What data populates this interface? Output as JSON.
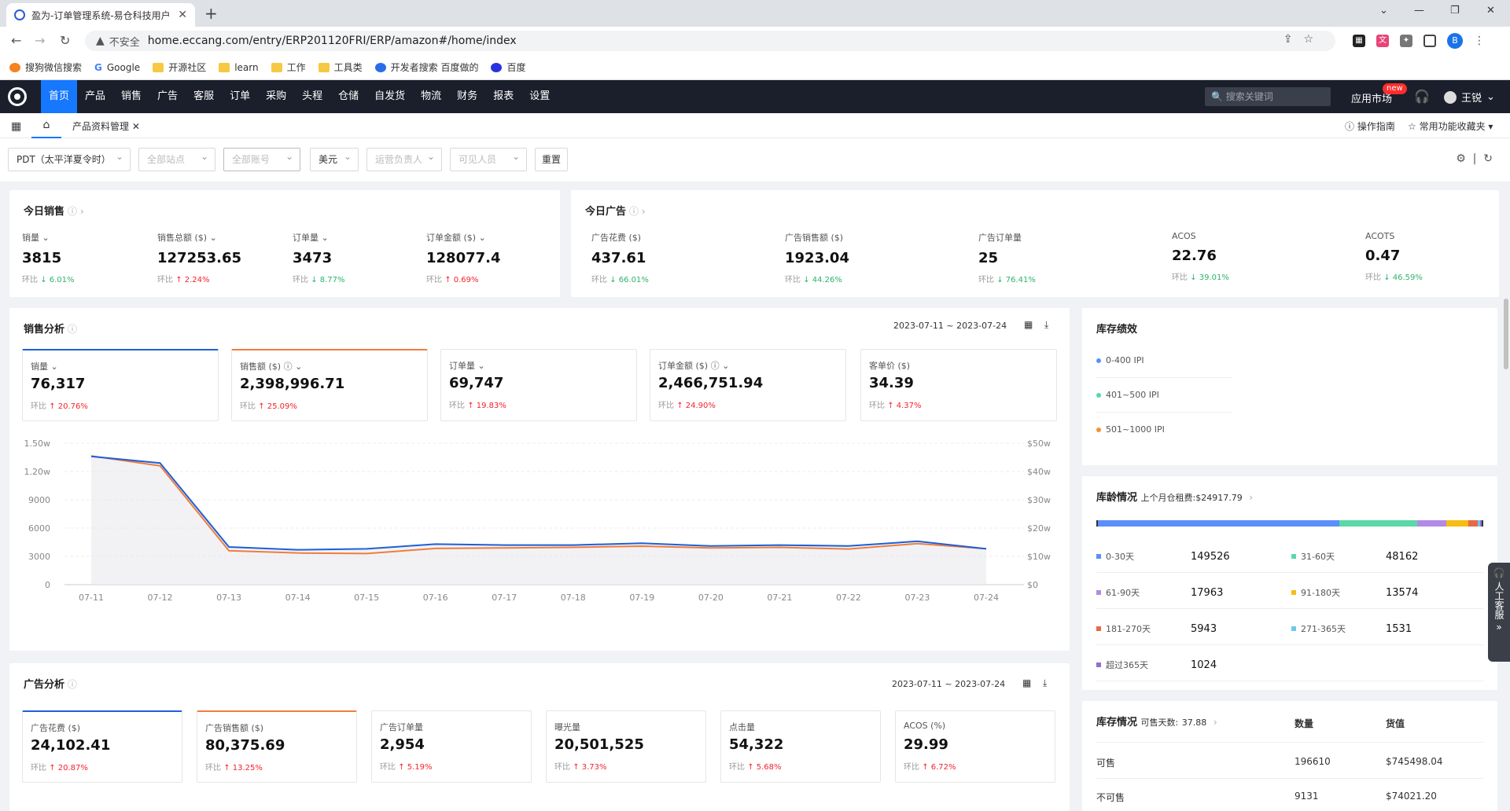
{
  "browser": {
    "tab_title": "盈为-订单管理系统-易仓科技用户",
    "security": "不安全",
    "url": "home.eccang.com/entry/ERP201120FRI/ERP/amazon#/home/index",
    "profile": "B",
    "bookmarks": [
      "搜狗微信搜索",
      "Google",
      "开源社区",
      "learn",
      "工作",
      "工具类",
      "开发者搜索 百度做的",
      "百度"
    ]
  },
  "topnav": {
    "items": [
      "首页",
      "产品",
      "销售",
      "广告",
      "客服",
      "订单",
      "采购",
      "头程",
      "仓储",
      "自发货",
      "物流",
      "财务",
      "报表",
      "设置"
    ],
    "search_placeholder": "搜索关键词",
    "app_market": "应用市场",
    "new_badge": "new",
    "user": "王锐"
  },
  "apptabs": {
    "tab": "产品资料管理",
    "help": "操作指南",
    "favorites": "常用功能收藏夹"
  },
  "filters": {
    "timezone": "PDT（太平洋夏令时）",
    "site": "全部站点",
    "account": "全部账号",
    "currency": "美元",
    "operator": "运营负责人",
    "visible": "可见人员",
    "reset": "重置"
  },
  "today_sales": {
    "title": "今日销售",
    "metrics": [
      {
        "label": "销量",
        "value": "3815",
        "cmp": "环比",
        "dir": "down",
        "pct": "6.01%"
      },
      {
        "label": "销售总额 ($)",
        "value": "127253.65",
        "cmp": "环比",
        "dir": "up",
        "pct": "2.24%"
      },
      {
        "label": "订单量",
        "value": "3473",
        "cmp": "环比",
        "dir": "down",
        "pct": "8.77%"
      },
      {
        "label": "订单金额 ($)",
        "value": "128077.4",
        "cmp": "环比",
        "dir": "up",
        "pct": "0.69%"
      }
    ]
  },
  "today_ads": {
    "title": "今日广告",
    "metrics": [
      {
        "label": "广告花费 ($)",
        "value": "437.61",
        "cmp": "环比",
        "dir": "down",
        "pct": "66.01%"
      },
      {
        "label": "广告销售额 ($)",
        "value": "1923.04",
        "cmp": "环比",
        "dir": "down",
        "pct": "44.26%"
      },
      {
        "label": "广告订单量",
        "value": "25",
        "cmp": "环比",
        "dir": "down",
        "pct": "76.41%"
      },
      {
        "label": "ACOS",
        "value": "22.76",
        "cmp": "环比",
        "dir": "down",
        "pct": "39.01%"
      },
      {
        "label": "ACOTS",
        "value": "0.47",
        "cmp": "环比",
        "dir": "down",
        "pct": "46.59%"
      }
    ]
  },
  "sales_analysis": {
    "title": "销售分析",
    "date_range": "2023-07-11 ~ 2023-07-24",
    "boxes": [
      {
        "label": "销量",
        "value": "76,317",
        "cmp": "环比",
        "dir": "up",
        "pct": "20.76%"
      },
      {
        "label": "销售额 ($)",
        "value": "2,398,996.71",
        "cmp": "环比",
        "dir": "up",
        "pct": "25.09%"
      },
      {
        "label": "订单量",
        "value": "69,747",
        "cmp": "环比",
        "dir": "up",
        "pct": "19.83%"
      },
      {
        "label": "订单金额 ($)",
        "value": "2,466,751.94",
        "cmp": "环比",
        "dir": "up",
        "pct": "24.90%"
      },
      {
        "label": "客单价 ($)",
        "value": "34.39",
        "cmp": "环比",
        "dir": "up",
        "pct": "4.37%"
      }
    ]
  },
  "chart_data": {
    "type": "line",
    "categories": [
      "07-11",
      "07-12",
      "07-13",
      "07-14",
      "07-15",
      "07-16",
      "07-17",
      "07-18",
      "07-19",
      "07-20",
      "07-21",
      "07-22",
      "07-23",
      "07-24"
    ],
    "y_left_ticks": [
      "0",
      "3000",
      "6000",
      "9000",
      "1.20w",
      "1.50w"
    ],
    "y_right_ticks": [
      "$0",
      "$10w",
      "$20w",
      "$30w",
      "$40w",
      "$50w"
    ],
    "ylim_left": [
      0,
      15000
    ],
    "ylim_right": [
      0,
      500000
    ],
    "series": [
      {
        "name": "销量",
        "axis": "left",
        "color": "#1f5fd6",
        "values": [
          13600,
          12900,
          4000,
          3700,
          3800,
          4300,
          4200,
          4200,
          4400,
          4100,
          4200,
          4100,
          4600,
          3800
        ]
      },
      {
        "name": "销售额 ($)",
        "axis": "right",
        "color": "#f07d3c",
        "values": [
          455000,
          420000,
          120000,
          112000,
          110000,
          128000,
          130000,
          132000,
          136000,
          130000,
          132000,
          126000,
          145000,
          127000
        ]
      }
    ]
  },
  "inventory_perf": {
    "title": "库存绩效",
    "legend": [
      {
        "label": "0-400 IPI",
        "color": "#5b8ff9"
      },
      {
        "label": "401~500 IPI",
        "color": "#5ad8a6"
      },
      {
        "label": "501~1000 IPI",
        "color": "#f6903d"
      }
    ]
  },
  "age": {
    "title": "库龄情况",
    "fee_label": "上个月仓租费:",
    "fee": "$24917.79",
    "bar": [
      {
        "label": "0-30天",
        "value": 149526,
        "color": "#5b8ff9"
      },
      {
        "label": "31-60天",
        "value": 48162,
        "color": "#5ad8a6"
      },
      {
        "label": "61-90天",
        "value": 17963,
        "color": "#b38ae6"
      },
      {
        "label": "91-180天",
        "value": 13574,
        "color": "#f6bd16"
      },
      {
        "label": "181-270天",
        "value": 5943,
        "color": "#e8684a"
      },
      {
        "label": "271-365天",
        "value": 1531,
        "color": "#6dc8ec"
      },
      {
        "label": "超过365天",
        "value": 1024,
        "color": "#9270ca"
      }
    ],
    "rows": [
      {
        "a": "0-30天",
        "an": "149526",
        "b": "31-60天",
        "bn": "48162"
      },
      {
        "a": "61-90天",
        "an": "17963",
        "b": "91-180天",
        "bn": "13574"
      },
      {
        "a": "181-270天",
        "an": "5943",
        "b": "271-365天",
        "bn": "1531"
      },
      {
        "a": "超过365天",
        "an": "1024"
      }
    ]
  },
  "stock": {
    "title": "库存情况",
    "days_label": "可售天数:",
    "days": "37.88",
    "col_qty": "数量",
    "col_val": "货值",
    "rows": [
      {
        "label": "可售",
        "qty": "196610",
        "val": "$745498.04"
      },
      {
        "label": "不可售",
        "qty": "9131",
        "val": "$74021.20"
      }
    ]
  },
  "ad_analysis": {
    "title": "广告分析",
    "date_range": "2023-07-11 ~ 2023-07-24",
    "boxes": [
      {
        "label": "广告花费 ($)",
        "value": "24,102.41",
        "cmp": "环比",
        "dir": "up",
        "pct": "20.87%"
      },
      {
        "label": "广告销售额 ($)",
        "value": "80,375.69",
        "cmp": "环比",
        "dir": "up",
        "pct": "13.25%"
      },
      {
        "label": "广告订单量",
        "value": "2,954",
        "cmp": "环比",
        "dir": "up",
        "pct": "5.19%"
      },
      {
        "label": "曝光量",
        "value": "20,501,525",
        "cmp": "环比",
        "dir": "up",
        "pct": "3.73%"
      },
      {
        "label": "点击量",
        "value": "54,322",
        "cmp": "环比",
        "dir": "up",
        "pct": "5.68%"
      },
      {
        "label": "ACOS (%)",
        "value": "29.99",
        "cmp": "环比",
        "dir": "up",
        "pct": "6.72%"
      }
    ]
  },
  "side_service": "人工客服"
}
